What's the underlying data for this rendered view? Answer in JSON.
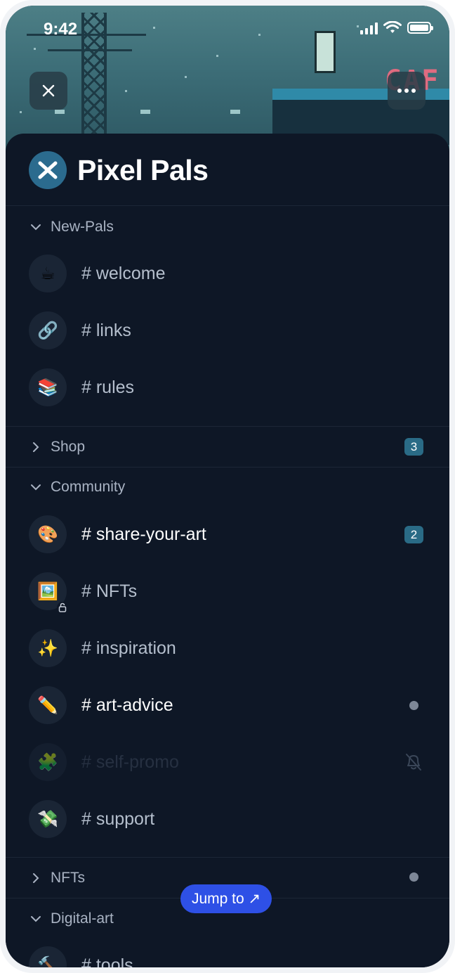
{
  "status_bar": {
    "time": "9:42"
  },
  "header": {
    "close_icon": "close-icon",
    "more_icon": "more-horizontal-icon",
    "banner_sign_text": "CAF"
  },
  "server": {
    "name": "Pixel Pals",
    "logo_icon": "x-logo-icon"
  },
  "categories": [
    {
      "name": "New-Pals",
      "expanded": true,
      "channels": [
        {
          "name": "# welcome",
          "icon": "☕"
        },
        {
          "name": "# links",
          "icon": "🔗"
        },
        {
          "name": "# rules",
          "icon": "📚"
        }
      ]
    },
    {
      "name": "Shop",
      "expanded": false,
      "badge": "3"
    },
    {
      "name": "Community",
      "expanded": true,
      "channels": [
        {
          "name": "# share-your-art",
          "icon": "🎨",
          "badge": "2"
        },
        {
          "name": "# NFTs",
          "icon": "🖼️",
          "locked": true
        },
        {
          "name": "# inspiration",
          "icon": "✨"
        },
        {
          "name": "# art-advice",
          "icon": "✏️",
          "unread": true
        },
        {
          "name": "# self-promo",
          "icon": "🧩",
          "muted": true
        },
        {
          "name": "# support",
          "icon": "💸"
        }
      ]
    },
    {
      "name": "NFTs",
      "expanded": false,
      "unread": true
    },
    {
      "name": "Digital-art",
      "expanded": true,
      "channels": [
        {
          "name": "# tools",
          "icon": "🔨"
        }
      ]
    }
  ],
  "jump_button": {
    "label": "Jump to ↗"
  },
  "colors": {
    "accent": "#2e50e6",
    "badge": "#2a6b86",
    "panel": "#0e1726"
  }
}
